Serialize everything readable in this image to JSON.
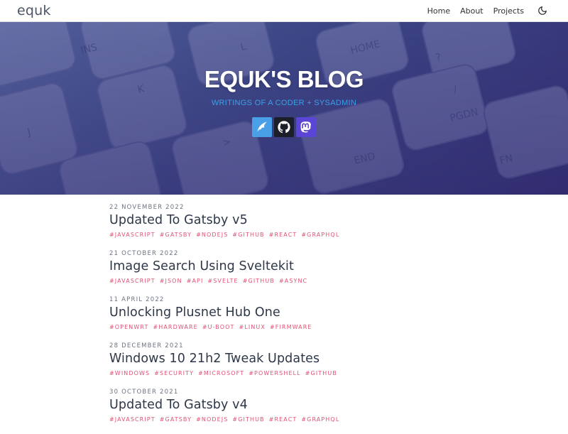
{
  "nav": {
    "brand": "equk",
    "links": [
      "Home",
      "About",
      "Projects"
    ],
    "theme_icon": "moon-icon"
  },
  "hero": {
    "title": "EQUK'S BLOG",
    "subtitle": "WRITINGS OF A CODER + SYSADMIN",
    "social": [
      {
        "icon": "fireship-icon",
        "color": "#4aa0e6"
      },
      {
        "icon": "github-icon",
        "color": "#1c1f28"
      },
      {
        "icon": "mastodon-icon",
        "color": "#5b45d6"
      }
    ]
  },
  "colors": {
    "tag": "#e05274",
    "subtitle": "#3b9fe8",
    "title": "#2d3748"
  },
  "posts": [
    {
      "date": "22 NOVEMBER 2022",
      "title": "Updated To Gatsby v5",
      "tags": [
        "#JAVASCRIPT",
        "#GATSBY",
        "#NODEJS",
        "#GITHUB",
        "#REACT",
        "#GRAPHQL"
      ]
    },
    {
      "date": "21 OCTOBER 2022",
      "title": "Image Search Using Sveltekit",
      "tags": [
        "#JAVASCRIPT",
        "#JSON",
        "#API",
        "#SVELTE",
        "#GITHUB",
        "#ASYNC"
      ]
    },
    {
      "date": "11 APRIL 2022",
      "title": "Unlocking Plusnet Hub One",
      "tags": [
        "#OPENWRT",
        "#HARDWARE",
        "#U-BOOT",
        "#LINUX",
        "#FIRMWARE"
      ]
    },
    {
      "date": "28 DECEMBER 2021",
      "title": "Windows 10 21h2 Tweak Updates",
      "tags": [
        "#WINDOWS",
        "#SECURITY",
        "#MICROSOFT",
        "#POWERSHELL",
        "#GITHUB"
      ]
    },
    {
      "date": "30 OCTOBER 2021",
      "title": "Updated To Gatsby v4",
      "tags": [
        "#JAVASCRIPT",
        "#GATSBY",
        "#NODEJS",
        "#GITHUB",
        "#REACT",
        "#GRAPHQL"
      ]
    }
  ]
}
